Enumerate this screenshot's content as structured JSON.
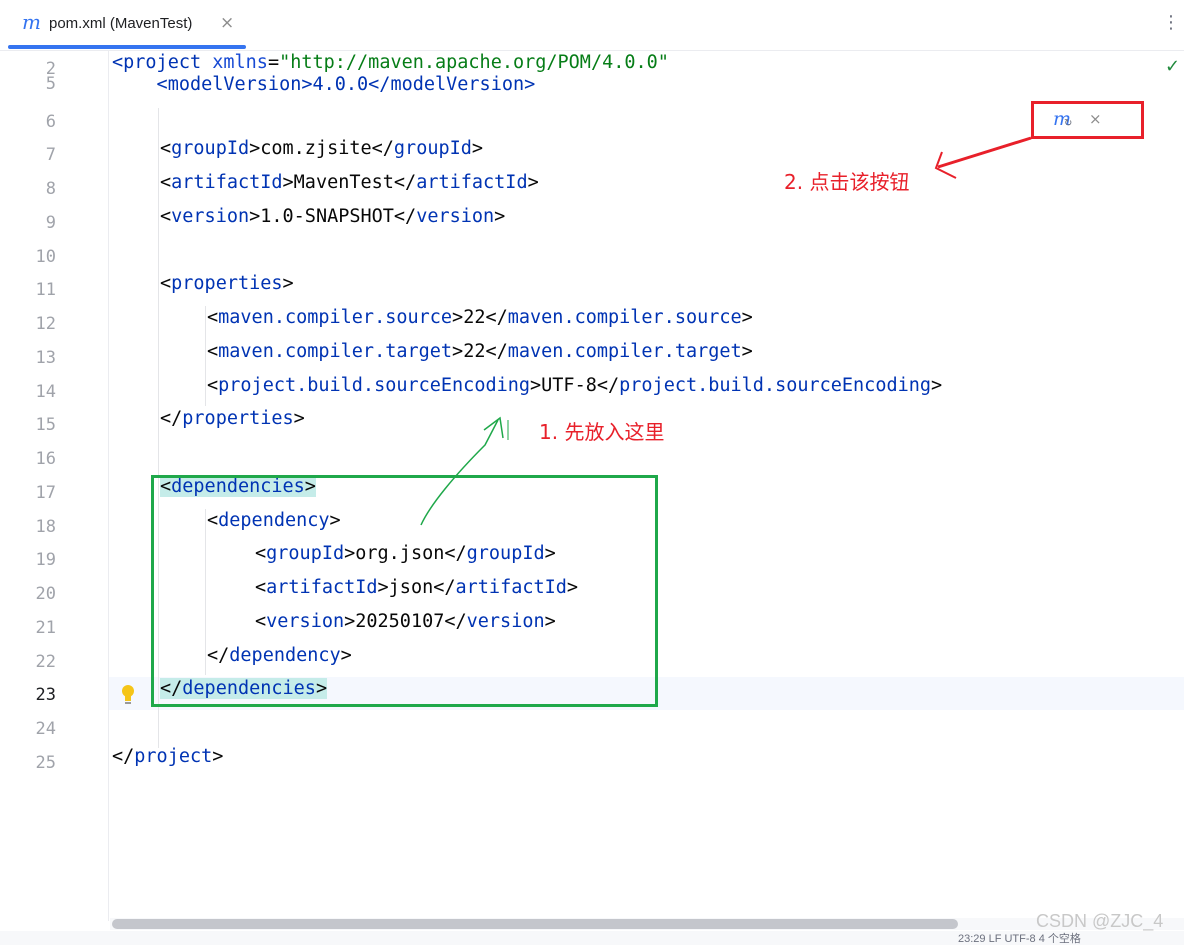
{
  "tab": {
    "icon": "maven-m-icon",
    "title": "pom.xml (MavenTest)",
    "close": "×"
  },
  "menu": {
    "kebab": "⋮"
  },
  "editor": {
    "check": "✓",
    "line_numbers": [
      "2",
      "5",
      "6",
      "7",
      "8",
      "9",
      "10",
      "11",
      "12",
      "13",
      "14",
      "15",
      "16",
      "17",
      "18",
      "19",
      "20",
      "21",
      "22",
      "23",
      "24",
      "25"
    ],
    "current_line": "23",
    "code": {
      "l2_open": "<",
      "l2_tag": "project",
      "l2_attr": " xmlns",
      "l2_eq": "=",
      "l2_str": "\"http://maven.apache.org/POM/4.0.0\"",
      "l5": "    <modelVersion>4.0.0</modelVersion>",
      "l7_tag": "groupId",
      "l7_val": "com.zjsite",
      "l8_tag": "artifactId",
      "l8_val": "MavenTest",
      "l9_tag": "version",
      "l9_val": "1.0-SNAPSHOT",
      "l11_tag": "properties",
      "l12_tag": "maven.compiler.source",
      "l12_val": "22",
      "l13_tag": "maven.compiler.target",
      "l13_val": "22",
      "l14_tag": "project.build.sourceEncoding",
      "l14_val": "UTF-8",
      "l15_tag": "properties",
      "l17_tag": "dependencies",
      "l18_tag": "dependency",
      "l19_tag": "groupId",
      "l19_val": "org.json",
      "l20_tag": "artifactId",
      "l20_val": "json",
      "l21_tag": "version",
      "l21_val": "20250107",
      "l22_tag": "dependency",
      "l23_tag": "dependencies",
      "l25_tag": "project"
    }
  },
  "maven_popup": {
    "icon": "maven-m-icon",
    "reload": "↻",
    "close": "×"
  },
  "annotations": {
    "step1": "1. 先放入这里",
    "step2": "2. 点击该按钮",
    "red": "#e8202a",
    "green": "#1fa84a"
  },
  "statusbar": {
    "text": "23:29   LF   UTF-8   4 个空格"
  },
  "watermark": "CSDN @ZJC_4"
}
